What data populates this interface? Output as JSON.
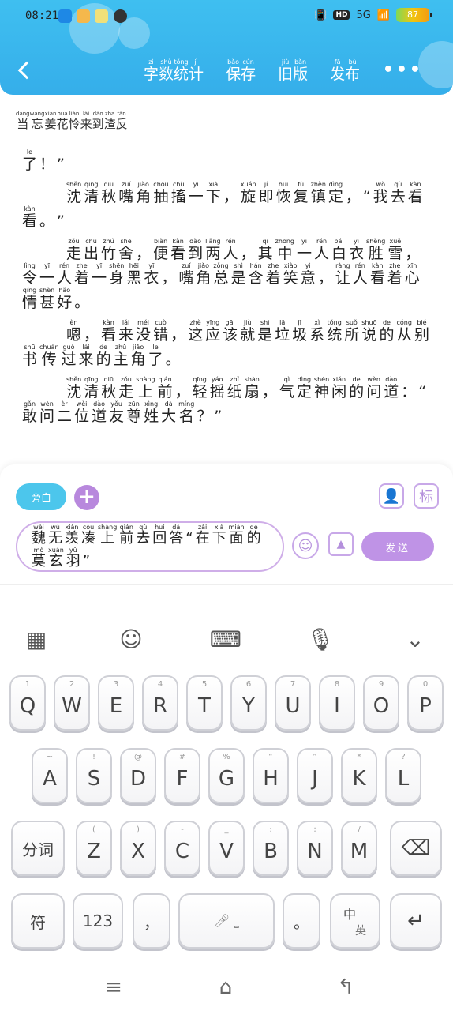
{
  "status_bar": {
    "time": "08:21",
    "network": "5G",
    "hd": "HD",
    "battery": "87"
  },
  "header": {
    "back_icon": "chevron-left-icon",
    "actions": [
      {
        "chars": [
          "字",
          "数",
          "统",
          "计"
        ],
        "pinyin": [
          "zì",
          "shù",
          "tǒng",
          "jì"
        ]
      },
      {
        "chars": [
          "保",
          "存"
        ],
        "pinyin": [
          "bǎo",
          "cún"
        ]
      },
      {
        "chars": [
          "旧",
          "版"
        ],
        "pinyin": [
          "jiù",
          "bǎn"
        ]
      },
      {
        "chars": [
          "发",
          "布"
        ],
        "pinyin": [
          "fā",
          "bù"
        ]
      }
    ],
    "more": "•••"
  },
  "content": {
    "prev_line": {
      "chars": [
        "当",
        "忘",
        "姜",
        "花",
        "怜",
        "来",
        "到",
        "渣",
        "反"
      ],
      "pinyin": [
        "dāng",
        "wàng",
        "xiān",
        "huā",
        "lián",
        "lái",
        "dào",
        "zhā",
        "fǎn"
      ]
    },
    "paragraphs": [
      {
        "indent": false,
        "chars": [
          "了",
          "！",
          "”"
        ],
        "pinyin": [
          "le",
          "",
          ""
        ]
      },
      {
        "indent": true,
        "chars": [
          "沈",
          "清",
          "秋",
          "嘴",
          "角",
          "抽",
          "搐",
          "一",
          "下",
          "，",
          "旋",
          "即",
          "恢",
          "复",
          "镇",
          "定",
          "，",
          "“",
          "我",
          "去",
          "看",
          "看",
          "。",
          "”"
        ],
        "pinyin": [
          "shěn",
          "qīng",
          "qiū",
          "zuǐ",
          "jiǎo",
          "chōu",
          "chù",
          "yī",
          "xià",
          "",
          "xuán",
          "jí",
          "huī",
          "fù",
          "zhèn",
          "dìng",
          "",
          "",
          "wǒ",
          "qù",
          "kàn",
          "kàn",
          "",
          ""
        ]
      },
      {
        "indent": true,
        "chars": [
          "走",
          "出",
          "竹",
          "舍",
          "，",
          "便",
          "看",
          "到",
          "两",
          "人",
          "，",
          "其",
          "中",
          "一",
          "人",
          "白",
          "衣",
          "胜",
          "雪",
          "，",
          "令",
          "一",
          "人",
          "着",
          "一",
          "身",
          "黑",
          "衣",
          "，",
          "嘴",
          "角",
          "总",
          "是",
          "含",
          "着",
          "笑",
          "意",
          "，",
          "让",
          "人",
          "看",
          "着",
          "心",
          "情",
          "甚",
          "好",
          "。"
        ],
        "pinyin": [
          "zǒu",
          "chū",
          "zhú",
          "shè",
          "",
          "biàn",
          "kàn",
          "dào",
          "liǎng",
          "rén",
          "",
          "qí",
          "zhōng",
          "yī",
          "rén",
          "bái",
          "yī",
          "shèng",
          "xuě",
          "",
          "lìng",
          "yī",
          "rén",
          "zhe",
          "yī",
          "shēn",
          "hēi",
          "yī",
          "",
          "zuǐ",
          "jiǎo",
          "zǒng",
          "shì",
          "hán",
          "zhe",
          "xiào",
          "yì",
          "",
          "ràng",
          "rén",
          "kàn",
          "zhe",
          "xīn",
          "qíng",
          "shèn",
          "hǎo",
          ""
        ]
      },
      {
        "indent": true,
        "chars": [
          "嗯",
          "，",
          "看",
          "来",
          "没",
          "错",
          "，",
          "这",
          "应",
          "该",
          "就",
          "是",
          "垃",
          "圾",
          "系",
          "统",
          "所",
          "说",
          "的",
          "从",
          "别",
          "书",
          "传",
          "过",
          "来",
          "的",
          "主",
          "角",
          "了",
          "。"
        ],
        "pinyin": [
          "èn",
          "",
          "kàn",
          "lái",
          "méi",
          "cuò",
          "",
          "zhè",
          "yīng",
          "gāi",
          "jiù",
          "shì",
          "lā",
          "jī",
          "xì",
          "tǒng",
          "suǒ",
          "shuō",
          "de",
          "cóng",
          "bié",
          "shū",
          "chuán",
          "guò",
          "lái",
          "de",
          "zhǔ",
          "jiǎo",
          "le",
          ""
        ]
      },
      {
        "indent": true,
        "chars": [
          "沈",
          "清",
          "秋",
          "走",
          "上",
          "前",
          "，",
          "轻",
          "摇",
          "纸",
          "扇",
          "，",
          "气",
          "定",
          "神",
          "闲",
          "的",
          "问",
          "道",
          "：",
          "“",
          "敢",
          "问",
          "二",
          "位",
          "道",
          "友",
          "尊",
          "姓",
          "大",
          "名",
          "？",
          "”"
        ],
        "pinyin": [
          "shěn",
          "qīng",
          "qiū",
          "zǒu",
          "shàng",
          "qián",
          "",
          "qīng",
          "yáo",
          "zhǐ",
          "shàn",
          "",
          "qì",
          "dìng",
          "shén",
          "xián",
          "de",
          "wèn",
          "dào",
          "",
          "",
          "gǎn",
          "wèn",
          "èr",
          "wèi",
          "dào",
          "yǒu",
          "zūn",
          "xìng",
          "dà",
          "míng",
          "",
          ""
        ]
      }
    ]
  },
  "composer": {
    "aside_label": "旁白",
    "plus": "+",
    "tag_label": "标",
    "message": {
      "chars": [
        "魏",
        "无",
        "羡",
        "凑",
        "上",
        "前",
        "去",
        "回",
        "答",
        "“",
        "在",
        "下",
        "面",
        "的",
        "莫",
        "玄",
        "羽",
        "”"
      ],
      "pinyin": [
        "wèi",
        "wú",
        "xiàn",
        "còu",
        "shàng",
        "qián",
        "qù",
        "huí",
        "dá",
        "",
        "zài",
        "xià",
        "miàn",
        "de",
        "mò",
        "xuán",
        "yǔ",
        ""
      ]
    },
    "send_label": "发送"
  },
  "keyboard": {
    "row1": [
      {
        "main": "Q",
        "sub": "1"
      },
      {
        "main": "W",
        "sub": "2"
      },
      {
        "main": "E",
        "sub": "3"
      },
      {
        "main": "R",
        "sub": "4"
      },
      {
        "main": "T",
        "sub": "5"
      },
      {
        "main": "Y",
        "sub": "6"
      },
      {
        "main": "U",
        "sub": "7"
      },
      {
        "main": "I",
        "sub": "8"
      },
      {
        "main": "O",
        "sub": "9"
      },
      {
        "main": "P",
        "sub": "0"
      }
    ],
    "row2": [
      {
        "main": "A",
        "sub": "~"
      },
      {
        "main": "S",
        "sub": "!"
      },
      {
        "main": "D",
        "sub": "@"
      },
      {
        "main": "F",
        "sub": "#"
      },
      {
        "main": "G",
        "sub": "%"
      },
      {
        "main": "H",
        "sub": "“"
      },
      {
        "main": "J",
        "sub": "”"
      },
      {
        "main": "K",
        "sub": "*"
      },
      {
        "main": "L",
        "sub": "?"
      }
    ],
    "row3_left": "分词",
    "row3": [
      {
        "main": "Z",
        "sub": "("
      },
      {
        "main": "X",
        "sub": ")"
      },
      {
        "main": "C",
        "sub": "-"
      },
      {
        "main": "V",
        "sub": "_"
      },
      {
        "main": "B",
        "sub": ":"
      },
      {
        "main": "N",
        "sub": ";"
      },
      {
        "main": "M",
        "sub": "/"
      }
    ],
    "backspace_icon": "backspace-icon",
    "row4": {
      "symbol": "符",
      "num": "123",
      "comma": "，",
      "space_icon": "microphone-space-icon",
      "period": "。",
      "lang_top": "中",
      "lang_bottom": "英",
      "enter_icon": "enter-icon"
    },
    "toolbar": [
      "grid-icon",
      "emoji-icon",
      "keyboard-icon",
      "microphone-icon",
      "collapse-chevron-icon"
    ]
  },
  "colors": {
    "header": "#3fbff0",
    "accent_blue": "#4cc6ec",
    "accent_purple": "#bf93e6"
  }
}
